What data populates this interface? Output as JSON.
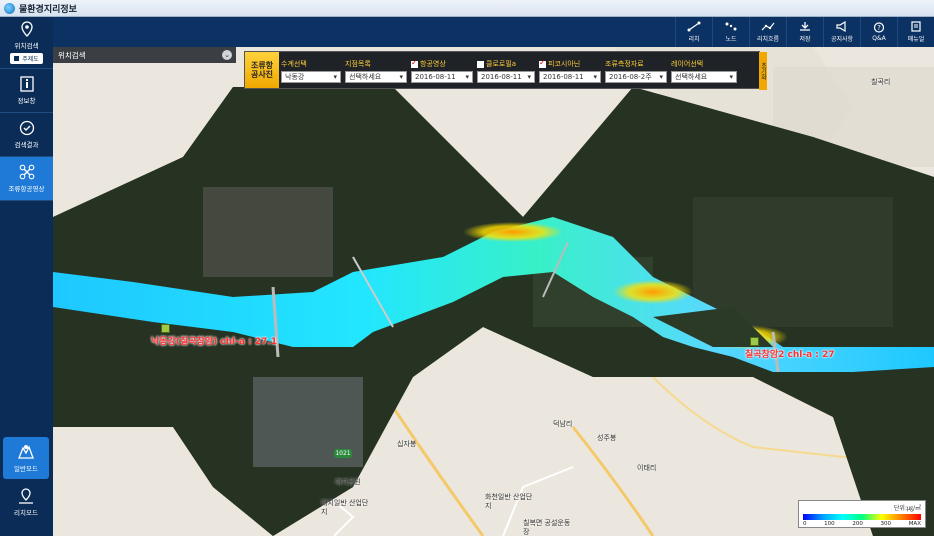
{
  "app": {
    "title": "물환경지리정보"
  },
  "toolbar": [
    {
      "label": "리치",
      "icon": "reach-icon"
    },
    {
      "label": "노드",
      "icon": "node-icon"
    },
    {
      "label": "리치흐름",
      "icon": "reach-flow-icon"
    },
    {
      "label": "저장",
      "icon": "save-icon"
    },
    {
      "label": "공지사항",
      "icon": "notice-icon"
    },
    {
      "label": "Q&A",
      "icon": "qna-icon"
    },
    {
      "label": "매뉴얼",
      "icon": "manual-icon"
    }
  ],
  "sidebar": {
    "items": [
      {
        "label": "위치검색",
        "sub": "주제도"
      },
      {
        "label": "정보창"
      },
      {
        "label": "검색결과"
      },
      {
        "label": "조류항공영상"
      }
    ],
    "bottom": [
      {
        "label": "일반모드"
      },
      {
        "label": "리치모드"
      }
    ]
  },
  "location_search": {
    "title": "위치검색"
  },
  "filter_panel": {
    "title": "조류항공사진",
    "side_label": "초기화",
    "fields": [
      {
        "header": "수계선택",
        "value": "낙동강",
        "checkbox": false,
        "checked": false
      },
      {
        "header": "지점목록",
        "value": "선택하세요",
        "checkbox": false,
        "checked": false
      },
      {
        "header": "항공영상",
        "value": "2016-08-11",
        "checkbox": true,
        "checked": true
      },
      {
        "header": "클로로필a",
        "value": "2016-08-11",
        "checkbox": true,
        "checked": false
      },
      {
        "header": "피코시아닌",
        "value": "2016-08-11",
        "checkbox": true,
        "checked": true
      },
      {
        "header": "조류측정자료",
        "value": "2016-08-2주",
        "checkbox": false,
        "checked": false
      },
      {
        "header": "레이어선택",
        "value": "선택하세요",
        "checkbox": false,
        "checked": false
      }
    ]
  },
  "map": {
    "station_labels": [
      "낙동강(칠곡창암) chl-a : 27.1",
      "칠곡창암2 chl-a : 27"
    ],
    "place_labels": [
      "십자봉",
      "대치공원",
      "대치일반 산업단지",
      "화천일반 산업단지",
      "칠복면 공설운동장",
      "성주봉",
      "이태리",
      "덕남리",
      "칠곡리"
    ],
    "road_number": "1021"
  },
  "legend": {
    "unit": "단위:㎍/㎥",
    "ticks": [
      "0",
      "100",
      "200",
      "300",
      "MAX"
    ]
  },
  "colors": {
    "sidebar": "#0a2c57",
    "topbar": "#0c3263",
    "active": "#1e7ad6",
    "panel_label": "#f0a800"
  }
}
